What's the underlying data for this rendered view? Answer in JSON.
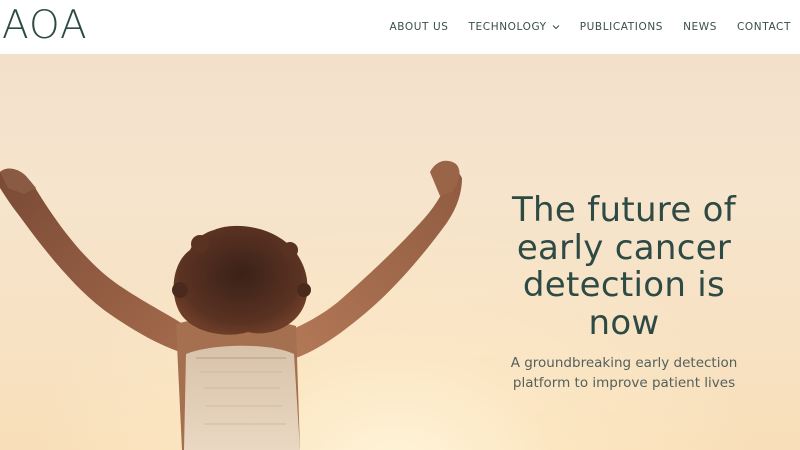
{
  "header": {
    "logo": "AOA",
    "nav": [
      {
        "label": "ABOUT US"
      },
      {
        "label": "TECHNOLOGY",
        "has_dropdown": true
      },
      {
        "label": "PUBLICATIONS"
      },
      {
        "label": "NEWS"
      },
      {
        "label": "CONTACT"
      }
    ]
  },
  "hero": {
    "title": "The future of early cancer detection is now",
    "subtitle": "A groundbreaking early detection platform to improve patient lives"
  },
  "colors": {
    "brand_text": "#2e4a45",
    "nav_text": "#3a4e4a",
    "hero_sky": "#f6e4cc"
  },
  "icons": {
    "dropdown": "chevron-down-icon"
  }
}
